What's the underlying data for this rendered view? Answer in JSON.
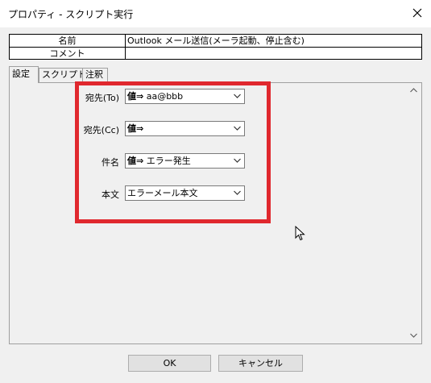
{
  "window": {
    "title": "プロパティ - スクリプト実行"
  },
  "info_table": {
    "rows": [
      {
        "label": "名前",
        "value": "Outlook メール送信(メーラ起動、停止含む)"
      },
      {
        "label": "コメント",
        "value": ""
      }
    ]
  },
  "tabs": [
    {
      "label": "設定",
      "active": true
    },
    {
      "label": "スクリプト",
      "active": false
    },
    {
      "label": "注釈",
      "active": false
    }
  ],
  "form": {
    "fields": [
      {
        "label": "宛先(To)",
        "value_prefix": "値⇒",
        "value": " aa@bbb"
      },
      {
        "label": "宛先(Cc)",
        "value_prefix": "値⇒",
        "value": ""
      },
      {
        "label": "件名",
        "value_prefix": "値⇒",
        "value": " エラー発生"
      },
      {
        "label": "本文",
        "value_prefix": "",
        "value": "エラーメール本文"
      }
    ]
  },
  "buttons": {
    "ok": "OK",
    "cancel": "キャンセル"
  },
  "colors": {
    "highlight": "#e0282e",
    "background": "#f0f0f0"
  },
  "icons": {
    "close": "close-icon",
    "combo_arrow": "chevron-down-icon",
    "scroll_up": "chevron-up-icon",
    "scroll_down": "chevron-down-icon",
    "cursor": "mouse-pointer-icon"
  }
}
